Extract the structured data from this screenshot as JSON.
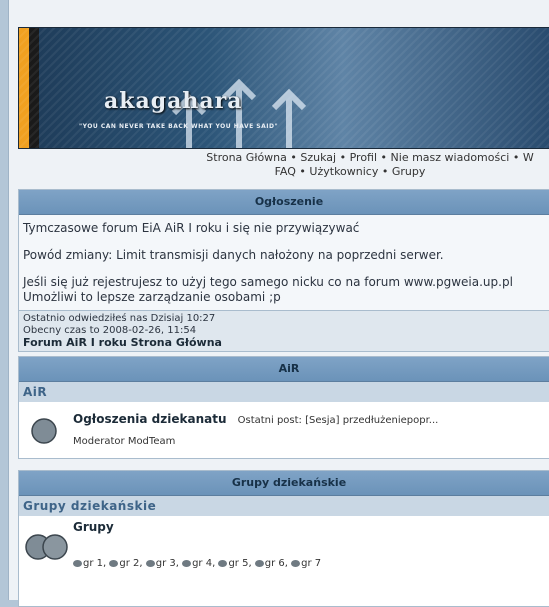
{
  "banner": {
    "logo": "akagahara",
    "tagline": "\"YOU CAN NEVER TAKE BACK WHAT YOU HAVE SAID\""
  },
  "nav": {
    "line1": [
      "Strona Główna",
      "Szukaj",
      "Profil",
      "Nie masz wiadomości",
      "W"
    ],
    "line2": [
      "FAQ",
      "Użytkownicy",
      "Grupy"
    ]
  },
  "announcement": {
    "header": "Ogłoszenie",
    "line1": "Tymczasowe forum EiA AiR I roku i się nie przywiązywać",
    "line2": "Powód zmiany: Limit transmisji danych nałożony na poprzedni serwer.",
    "line3": "Jeśli się już rejestrujesz to użyj tego samego nicku co na forum www.pgweia.up.pl",
    "line4": "Umożliwi to lepsze zarządzanie osobami ;p"
  },
  "info": {
    "last_visit": "Ostatnio odwiedziłeś nas Dzisiaj 10:27",
    "current_time": "Obecny czas to 2008-02-26, 11:54",
    "forum_home": "Forum AiR I roku Strona Główna"
  },
  "section_air": {
    "header": "AiR",
    "category": "AiR",
    "forum_title": "Ogłoszenia dziekanatu",
    "last_post": "Ostatni post: [Sesja] przedłużeniepopr...",
    "moderator": "Moderator ModTeam"
  },
  "section_groups": {
    "header": "Grupy dziekańskie",
    "category": "Grupy dziekańskie",
    "forum_title": "Grupy",
    "groups": [
      "gr 1",
      "gr 2",
      "gr 3",
      "gr 4",
      "gr 5",
      "gr 6",
      "gr 7"
    ]
  }
}
